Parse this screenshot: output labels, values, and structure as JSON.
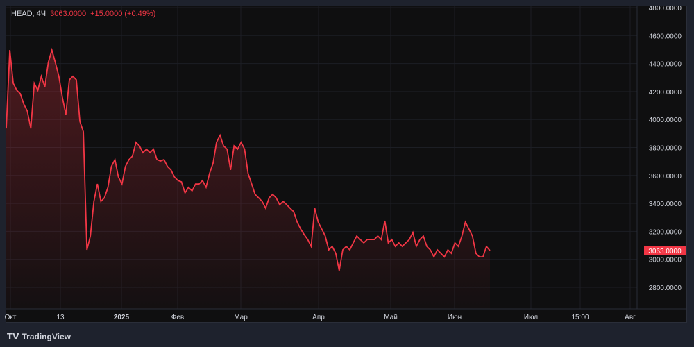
{
  "legend": {
    "symbol": "HEAD, 4Ч",
    "price": "3063.0000",
    "change": "+15.0000 (+0.49%)"
  },
  "price_axis": {
    "labels": [
      "4800.0000",
      "4600.0000",
      "4400.0000",
      "4200.0000",
      "4000.0000",
      "3800.0000",
      "3600.0000",
      "3400.0000",
      "3200.0000",
      "3000.0000",
      "2800.0000"
    ],
    "values": [
      4800,
      4600,
      4400,
      4200,
      4000,
      3800,
      3600,
      3400,
      3200,
      3000,
      2800
    ],
    "last_price_label": "3063.0000",
    "last_price": 3063
  },
  "time_axis": {
    "labels": [
      "Окт",
      "13",
      "2025",
      "Фев",
      "Мар",
      "Апр",
      "Май",
      "Июн",
      "Июл",
      "15:00",
      "Авг"
    ]
  },
  "colors": {
    "line": "#f23645",
    "background": "#0f0f10"
  },
  "brand": "TradingView",
  "series": [
    3936,
    4497,
    4259,
    4209,
    4185,
    4110,
    4061,
    3936,
    4259,
    4209,
    4309,
    4234,
    4408,
    4497,
    4408,
    4309,
    4160,
    4036,
    4284,
    4309,
    4284,
    3986,
    3912,
    3068,
    3167,
    3415,
    3539,
    3415,
    3440,
    3515,
    3664,
    3713,
    3589,
    3539,
    3664,
    3713,
    3738,
    3837,
    3812,
    3763,
    3788,
    3763,
    3788,
    3713,
    3703,
    3713,
    3664,
    3639,
    3589,
    3564,
    3554,
    3475,
    3515,
    3490,
    3539,
    3539,
    3564,
    3515,
    3614,
    3688,
    3837,
    3887,
    3812,
    3788,
    3639,
    3812,
    3788,
    3837,
    3788,
    3614,
    3539,
    3465,
    3440,
    3415,
    3366,
    3440,
    3465,
    3440,
    3391,
    3415,
    3391,
    3366,
    3341,
    3267,
    3217,
    3177,
    3142,
    3093,
    3366,
    3267,
    3217,
    3167,
    3068,
    3093,
    3043,
    2919,
    3068,
    3093,
    3068,
    3118,
    3167,
    3142,
    3118,
    3142,
    3142,
    3142,
    3167,
    3142,
    3276,
    3118,
    3142,
    3093,
    3118,
    3093,
    3118,
    3142,
    3192,
    3093,
    3142,
    3167,
    3093,
    3068,
    3018,
    3068,
    3043,
    3018,
    3068,
    3043,
    3118,
    3093,
    3167,
    3267,
    3217,
    3167,
    3043,
    3018,
    3018,
    3093,
    3063
  ]
}
